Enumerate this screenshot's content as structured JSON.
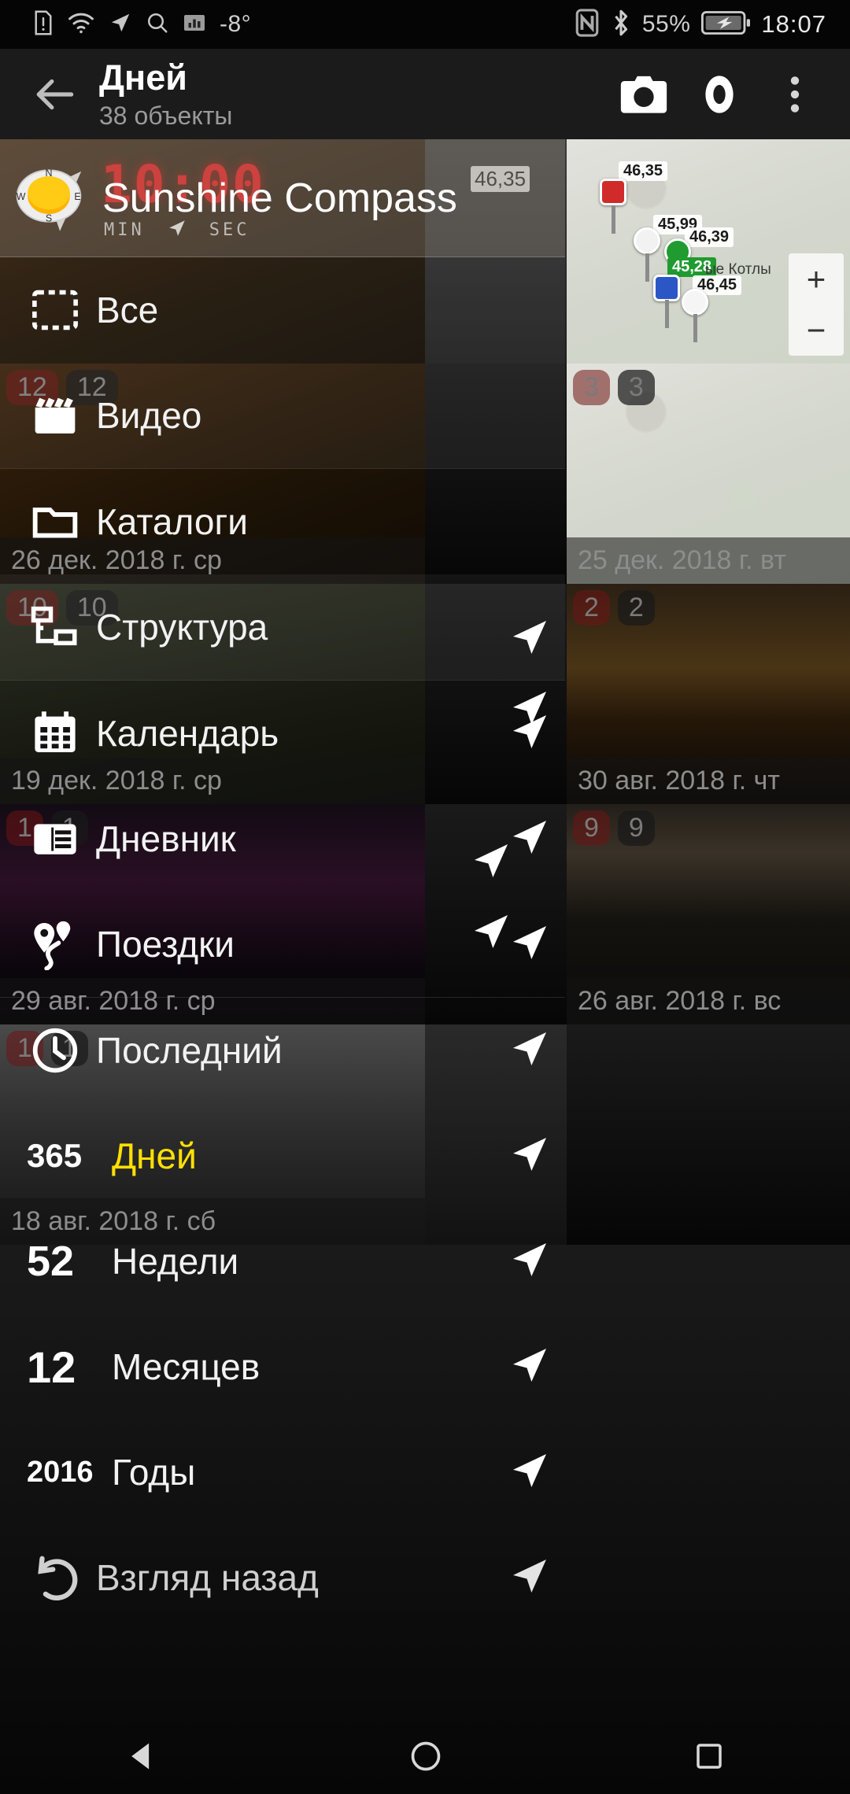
{
  "statusbar": {
    "left_icons": [
      "sim-alert-icon",
      "wifi-icon",
      "location-arrow-icon",
      "search-icon",
      "signal-bars-icon"
    ],
    "temperature": "-8°",
    "right_icons": [
      "nfc-icon",
      "bluetooth-icon"
    ],
    "battery_percent": "55%",
    "battery_state": "charging",
    "clock": "18:07"
  },
  "appbar": {
    "back_icon": "back-arrow-icon",
    "title": "Дней",
    "subtitle": "38 объекты",
    "actions": [
      {
        "name": "camera-icon",
        "label": "Камера"
      },
      {
        "name": "eye-icon",
        "label": "Просмотр"
      },
      {
        "name": "overflow-menu-icon",
        "label": "Ещё"
      }
    ]
  },
  "timer": {
    "digits": "10:00",
    "min_label": "MIN",
    "sec_label": "SEC",
    "arrow_icon": "location-arrow-icon"
  },
  "drawer": {
    "header_title": "Sunshine Compass",
    "header_icon": "sun-compass-icon",
    "compass_letters": {
      "n": "N",
      "e": "E",
      "s": "S",
      "w": "W"
    },
    "sections": [
      {
        "items": [
          {
            "icon": "select-all-icon",
            "label": "Все",
            "number": "",
            "arrow": false,
            "active": false,
            "tint": true
          },
          {
            "icon": "video-clap-icon",
            "label": "Видео",
            "number": "",
            "arrow": false,
            "active": false,
            "tint": true
          }
        ]
      },
      {
        "items": [
          {
            "icon": "folder-icon",
            "label": "Каталоги",
            "number": "",
            "arrow": false,
            "active": false,
            "tint": false
          },
          {
            "icon": "folder-tree-icon",
            "label": "Структура",
            "number": "",
            "arrow": false,
            "active": false,
            "tint": true
          }
        ]
      },
      {
        "items": [
          {
            "icon": "calendar-icon",
            "label": "Календарь",
            "number": "",
            "arrow": true,
            "active": false,
            "tint": false
          },
          {
            "icon": "journal-icon",
            "label": "Дневник",
            "number": "",
            "arrow": true,
            "active": false,
            "tint": false
          },
          {
            "icon": "map-pins-icon",
            "label": "Поездки",
            "number": "",
            "arrow": true,
            "active": false,
            "tint": false
          }
        ]
      },
      {
        "items": [
          {
            "icon": "clock-icon",
            "label": "Последний",
            "number": "",
            "arrow": true,
            "active": false,
            "tint": false
          },
          {
            "icon": "",
            "label": "Дней",
            "number": "365",
            "arrow": true,
            "active": true,
            "tint": false
          },
          {
            "icon": "",
            "label": "Недели",
            "number": "52",
            "arrow": true,
            "active": false,
            "tint": false
          },
          {
            "icon": "",
            "label": "Месяцев",
            "number": "12",
            "arrow": true,
            "active": false,
            "tint": false
          },
          {
            "icon": "",
            "label": "Годы",
            "number": "2016",
            "arrow": true,
            "active": false,
            "tint": false
          },
          {
            "icon": "undo-icon",
            "label": "Взгляд назад",
            "number": "",
            "arrow": true,
            "active": false,
            "tint": false
          }
        ]
      }
    ]
  },
  "gallery": {
    "rows": [
      {
        "cells": [
          {
            "photo": "ph-brown",
            "date": "",
            "count": "",
            "geo": "",
            "arrow": false
          },
          {
            "photo": "ph-gray",
            "date": "",
            "count": "",
            "geo": "",
            "arrow": false
          },
          {
            "photo": "ph-map",
            "date": "",
            "count": "",
            "geo": "",
            "arrow": false
          }
        ]
      },
      {
        "cells": [
          {
            "photo": "ph-brown",
            "date": "26 дек. 2018 г. ср",
            "count": "12",
            "geo": "12",
            "arrow": false
          },
          {
            "photo": "ph-dark",
            "date": "",
            "count": "",
            "geo": "",
            "arrow": false
          },
          {
            "photo": "ph-map",
            "date": "25 дек. 2018 г. вт",
            "count": "3",
            "geo": "3",
            "arrow": false
          }
        ]
      },
      {
        "cells": [
          {
            "photo": "ph-mapdk",
            "date": "19 дек. 2018 г. ср",
            "count": "10",
            "geo": "10",
            "arrow": false
          },
          {
            "photo": "ph-dark",
            "date": "",
            "count": "",
            "geo": "",
            "arrow": false
          },
          {
            "photo": "ph-sunset",
            "date": "30 авг. 2018 г. чт",
            "count": "2",
            "geo": "2",
            "arrow": false
          }
        ]
      },
      {
        "cells": [
          {
            "photo": "ph-night",
            "date": "29 авг. 2018 г. ср",
            "count": "1",
            "geo": "1",
            "arrow": true
          },
          {
            "photo": "ph-dark",
            "date": "",
            "count": "",
            "geo": "",
            "arrow": true
          },
          {
            "photo": "ph-river",
            "date": "26 авг. 2018 г. вс",
            "count": "9",
            "geo": "9",
            "arrow": true
          }
        ]
      },
      {
        "cells": [
          {
            "photo": "ph-bw",
            "date": "18 авг. 2018 г. сб",
            "count": "1",
            "geo": "1",
            "arrow": true
          },
          {
            "photo": "ph-bw2",
            "date": "",
            "count": "",
            "geo": "",
            "arrow": true
          },
          {
            "photo": "ph-dark",
            "date": "",
            "count": "",
            "geo": "",
            "arrow": true
          }
        ]
      }
    ],
    "map_thumbnail": {
      "price_tags": [
        "46,35",
        "45,99",
        "46,39",
        "45,28",
        "46,45"
      ],
      "highlighted_price": "45,28",
      "place_label": "ые Котлы",
      "zoom_in": "+",
      "zoom_out": "−"
    }
  },
  "navbar": {
    "buttons": [
      {
        "name": "android-back-button",
        "glyph": "back-triangle"
      },
      {
        "name": "android-home-button",
        "glyph": "circle"
      },
      {
        "name": "android-recents-button",
        "glyph": "square"
      }
    ]
  },
  "colors": {
    "accent_active": "#ffe000",
    "timer_red": "#ee1111",
    "price_green": "#1f9b2f",
    "appbar_bg": "#1b1b1b"
  }
}
